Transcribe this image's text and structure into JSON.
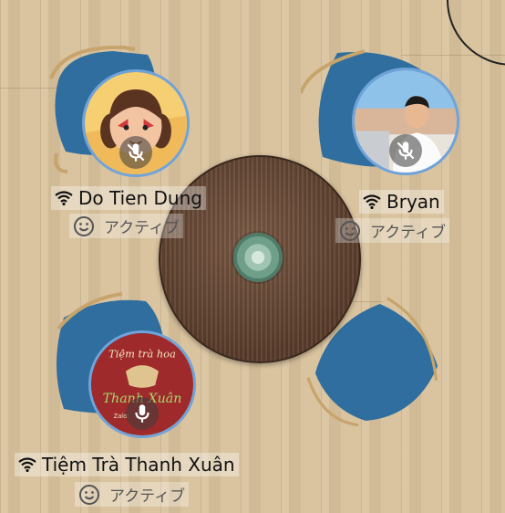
{
  "participants": [
    {
      "name": "Do Tien Dung",
      "status": "アクティブ",
      "mic": "muted"
    },
    {
      "name": "Bryan",
      "status": "アクティブ",
      "mic": "muted"
    },
    {
      "name": "Tiệm Trà Thanh Xuân",
      "status": "アクティブ",
      "mic": "on",
      "avatar_text": {
        "line1": "Tiệm trà hoa",
        "line2": "Thanh Xuân",
        "line3": "Zalo: "
      }
    }
  ],
  "colors": {
    "chair": "#2f6e9e",
    "avatar_ring": "#6fa3d9",
    "table": "#5e4230",
    "floor": "#d8c19b"
  },
  "icons": {
    "signal": "wifi-signal-icon",
    "status": "smiley-icon",
    "muted": "mic-off-icon",
    "mic": "mic-icon"
  }
}
